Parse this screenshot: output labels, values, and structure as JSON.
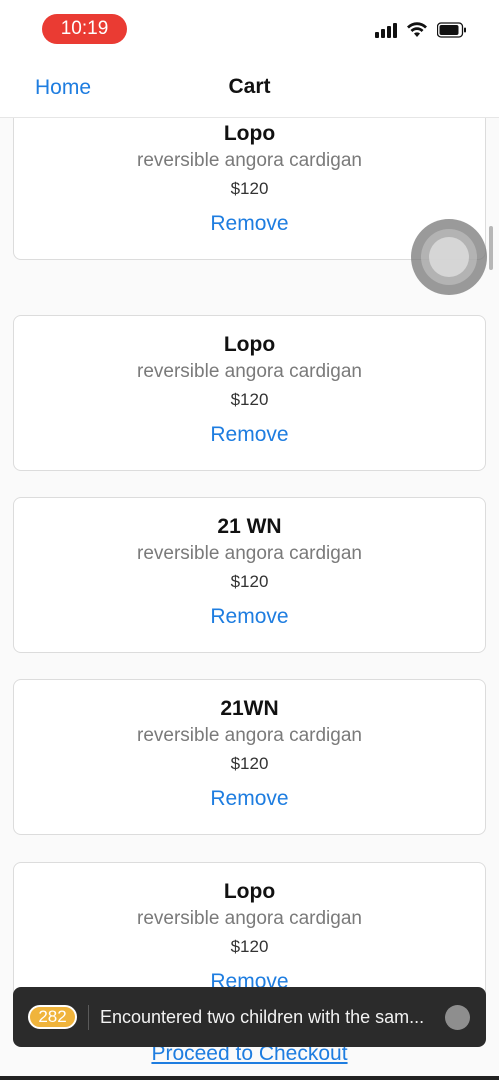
{
  "status_bar": {
    "time": "10:19",
    "icons": [
      "signal-icon",
      "wifi-icon",
      "battery-icon"
    ]
  },
  "nav": {
    "back_label": "Home",
    "title": "Cart"
  },
  "cart": {
    "items": [
      {
        "brand": "Lopo",
        "description": "reversible angora cardigan",
        "price": "$120",
        "remove_label": "Remove"
      },
      {
        "brand": "Lopo",
        "description": "reversible angora cardigan",
        "price": "$120",
        "remove_label": "Remove"
      },
      {
        "brand": "21 WN",
        "description": "reversible angora cardigan",
        "price": "$120",
        "remove_label": "Remove"
      },
      {
        "brand": "21WN",
        "description": "reversible angora cardigan",
        "price": "$120",
        "remove_label": "Remove"
      },
      {
        "brand": "Lopo",
        "description": "reversible angora cardigan",
        "price": "$120",
        "remove_label": "Remove"
      }
    ],
    "checkout_label": "Proceed to Checkout"
  },
  "toast": {
    "count": "282",
    "message": "Encountered two children with the sam..."
  },
  "colors": {
    "accent": "#1e7de0",
    "time_pill": "#ea3b33",
    "badge": "#f0b43c",
    "toast_bg": "#2b2b2b"
  }
}
